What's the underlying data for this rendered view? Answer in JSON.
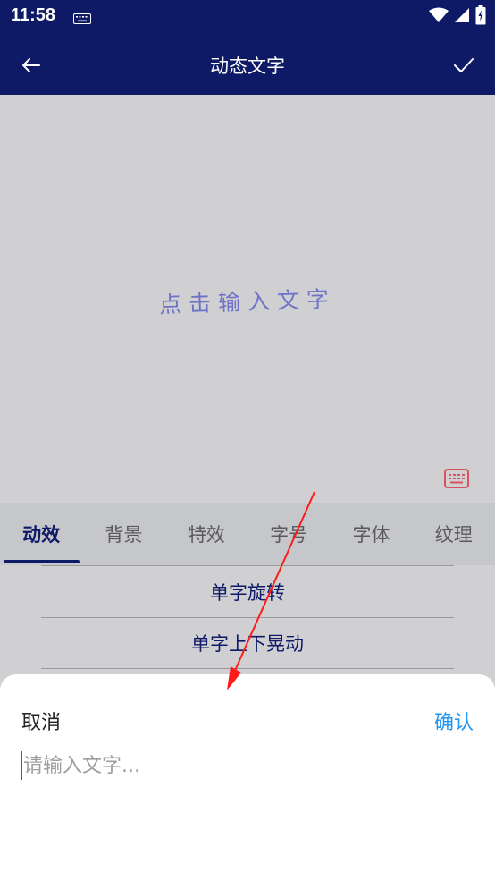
{
  "status_bar": {
    "time": "11:58",
    "icons": [
      "keyboard-icon",
      "wifi-icon",
      "signal-icon",
      "battery-charging-icon"
    ]
  },
  "app_bar": {
    "title": "动态文字",
    "back_icon": "arrow-left-icon",
    "confirm_icon": "check-icon"
  },
  "canvas": {
    "placeholder_text": "点击输入文字",
    "text_color": "#6f73c8",
    "keyboard_icon": "keyboard-icon"
  },
  "tabs": [
    {
      "label": "动效",
      "active": true
    },
    {
      "label": "背景",
      "active": false
    },
    {
      "label": "特效",
      "active": false
    },
    {
      "label": "字号",
      "active": false
    },
    {
      "label": "字体",
      "active": false
    },
    {
      "label": "纹理",
      "active": false
    }
  ],
  "effects": [
    "单字旋转",
    "单字上下晃动"
  ],
  "input_sheet": {
    "cancel_label": "取消",
    "confirm_label": "确认",
    "input_placeholder": "请输入文字...",
    "input_value": ""
  },
  "colors": {
    "primary": "#0f1a66",
    "accent": "#2196f3",
    "annotation_arrow": "#ff1a1a"
  }
}
